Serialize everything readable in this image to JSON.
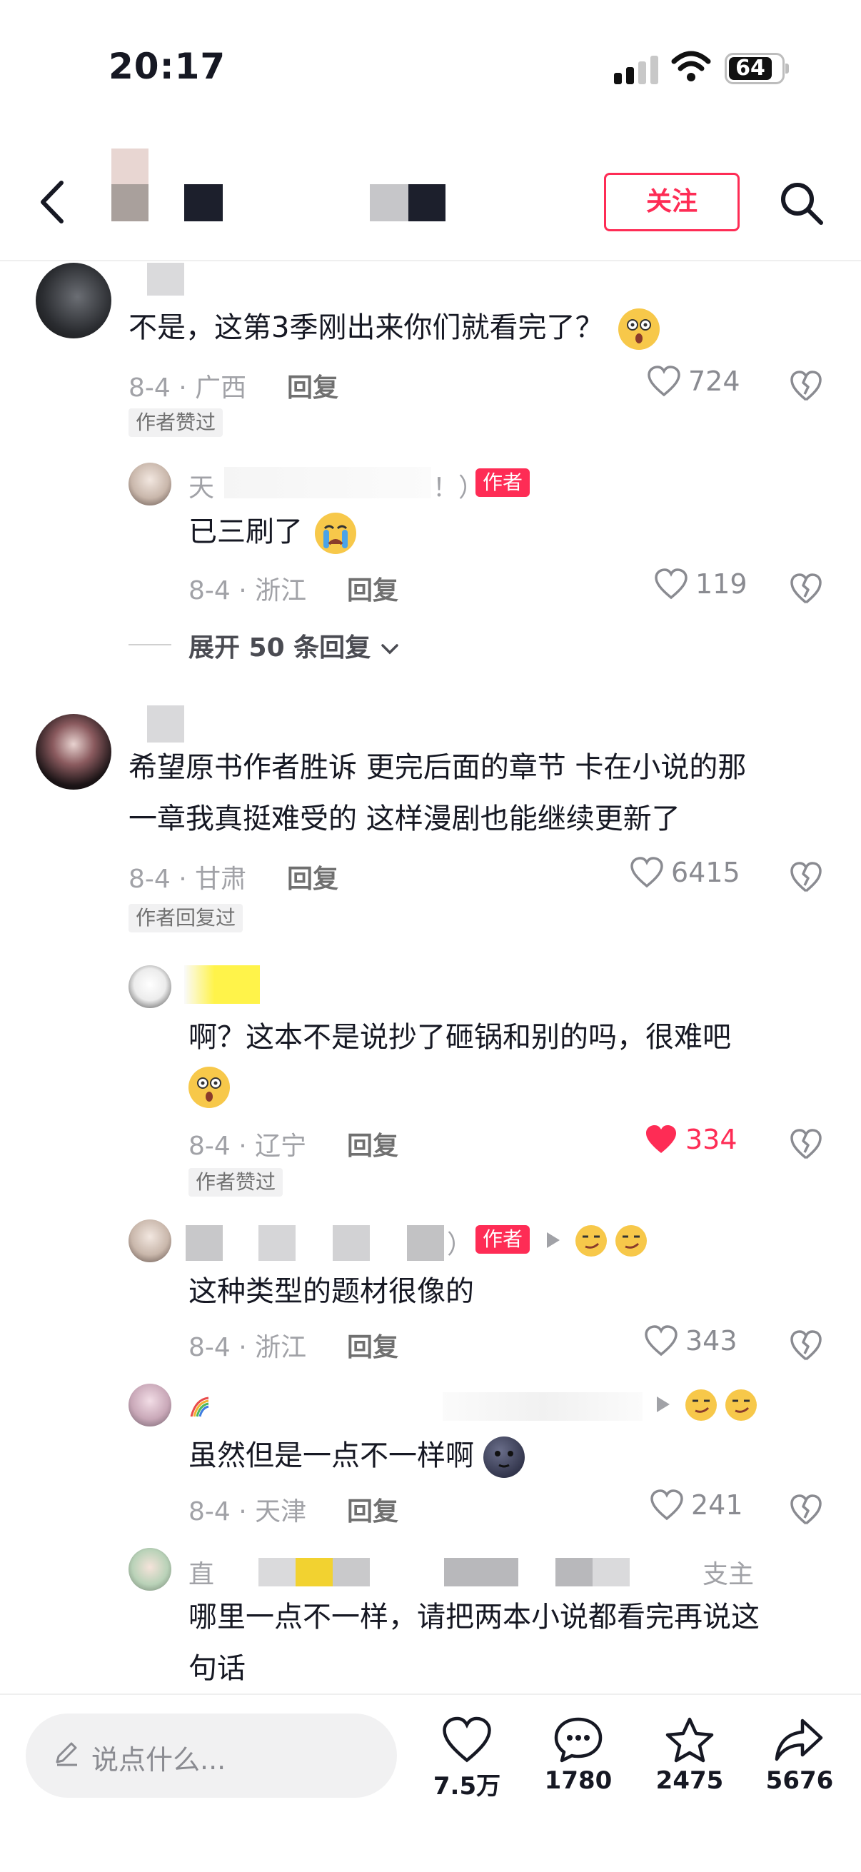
{
  "status_bar": {
    "time": "20:17",
    "battery": "64"
  },
  "header": {
    "follow_label": "关注"
  },
  "comments": [
    {
      "text": "不是，这第3季刚出来你们就看完了？",
      "date": "8-4 · 广西",
      "reply": "回复",
      "likes": "724",
      "tag": "作者赞过"
    },
    {
      "name": "天",
      "name_suffix": "！）",
      "badge": "作者",
      "text": "已三刷了",
      "date": "8-4 · 浙江",
      "reply": "回复",
      "likes": "119"
    },
    {
      "text_line1": "希望原书作者胜诉 更完后面的章节 卡在小说的那",
      "text_line2": "一章我真挺难受的 这样漫剧也能继续更新了",
      "date": "8-4 · 甘肃",
      "reply": "回复",
      "likes": "6415",
      "tag": "作者回复过"
    },
    {
      "text": "啊？这本不是说抄了砸锅和别的吗，很难吧",
      "date": "8-4 · 辽宁",
      "reply": "回复",
      "likes": "334",
      "tag": "作者赞过"
    },
    {
      "name_suffix": "）",
      "badge": "作者",
      "text": "这种类型的题材很像的",
      "date": "8-4 · 浙江",
      "reply": "回复",
      "likes": "343"
    },
    {
      "text": "虽然但是一点不一样啊",
      "date": "8-4 · 天津",
      "reply": "回复",
      "likes": "241"
    },
    {
      "name": "直",
      "name_tail": "支主",
      "text_line1": "哪里一点不一样，请把两本小说都看完再说这",
      "text_line2": "句话"
    }
  ],
  "expand_label": "展开 50 条回复",
  "bottom_bar": {
    "placeholder": "说点什么...",
    "likes": "7.5万",
    "comments": "1780",
    "favorites": "2475",
    "shares": "5676"
  },
  "colors": {
    "accent": "#fe2c55",
    "muted": "#a1a2a7"
  },
  "icons": [
    "back-arrow-icon",
    "search-icon",
    "heart-icon",
    "broken-heart-icon",
    "chat-bubble-icon",
    "star-icon",
    "share-arrow-icon",
    "pen-icon"
  ]
}
